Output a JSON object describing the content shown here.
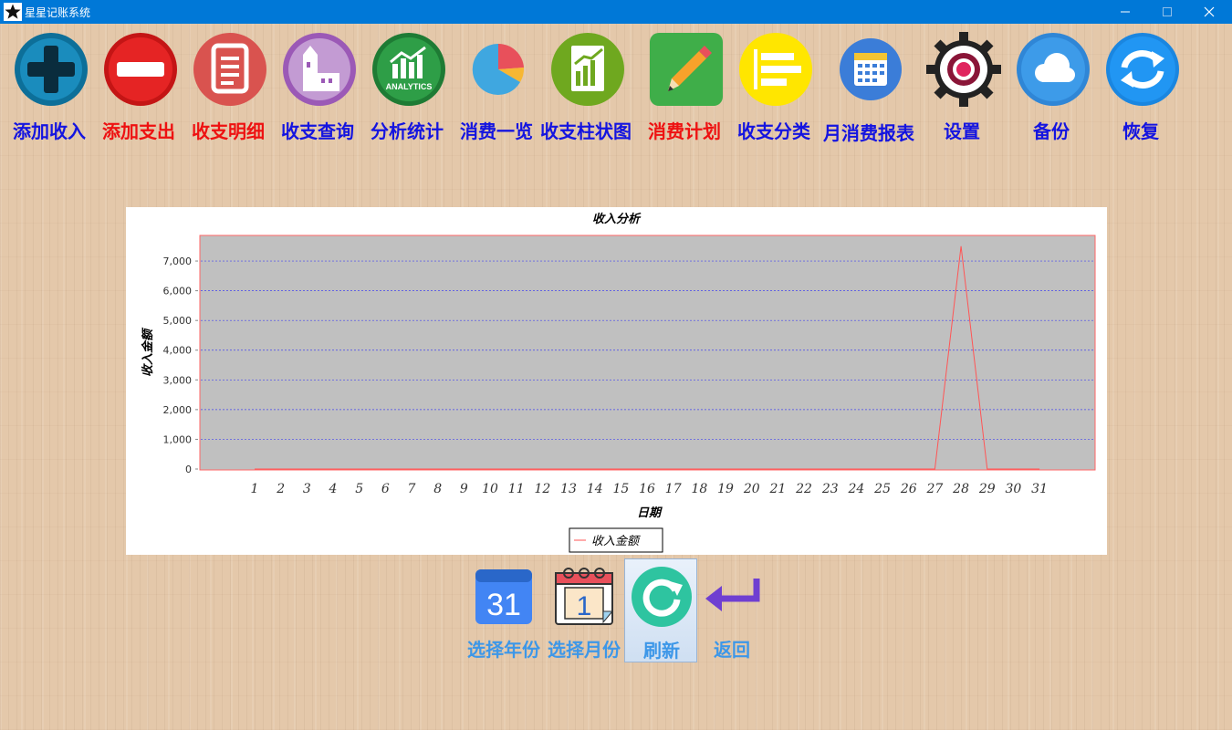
{
  "window": {
    "title": "星星记账系统",
    "minimize_icon": "minimize-icon",
    "maximize_icon": "maximize-icon",
    "close_icon": "close-icon"
  },
  "toolbar": {
    "items": [
      {
        "label": "添加收入",
        "icon": "add-icon",
        "color": "#1414e0"
      },
      {
        "label": "添加支出",
        "icon": "remove-icon",
        "color": "#ee1111"
      },
      {
        "label": "收支明细",
        "icon": "document-icon",
        "color": "#ee1111"
      },
      {
        "label": "收支查询",
        "icon": "building-icon",
        "color": "#1414e0"
      },
      {
        "label": "分析统计",
        "icon": "analytics-icon",
        "icon_text": "ANALYTICS",
        "color": "#1414e0"
      },
      {
        "label": "消费一览",
        "icon": "pie-chart-icon",
        "color": "#1414e0"
      },
      {
        "label": "收支柱状图",
        "icon": "bar-chart-icon",
        "color": "#1414e0"
      },
      {
        "label": "消费计划",
        "icon": "pencil-icon",
        "color": "#ee1111"
      },
      {
        "label": "收支分类",
        "icon": "list-icon",
        "color": "#1414e0"
      },
      {
        "label": "月消费报表",
        "icon": "calendar-icon",
        "color": "#1414e0"
      },
      {
        "label": "设置",
        "icon": "gear-icon",
        "color": "#1414e0"
      },
      {
        "label": "备份",
        "icon": "cloud-icon",
        "color": "#1414e0"
      },
      {
        "label": "恢复",
        "icon": "sync-icon",
        "color": "#1414e0"
      }
    ]
  },
  "chart_data": {
    "type": "line",
    "title": "收入分析",
    "xlabel": "日期",
    "ylabel": "收入金额",
    "legend": "收入金额",
    "legend_position": "bottom",
    "grid": true,
    "plot_background": "#c0c0c0",
    "line_color": "#ff5555",
    "grid_color": "#4444ee",
    "x": [
      1,
      2,
      3,
      4,
      5,
      6,
      7,
      8,
      9,
      10,
      11,
      12,
      13,
      14,
      15,
      16,
      17,
      18,
      19,
      20,
      21,
      22,
      23,
      24,
      25,
      26,
      27,
      28,
      29,
      30,
      31
    ],
    "y": [
      0,
      0,
      0,
      0,
      0,
      0,
      0,
      0,
      0,
      0,
      0,
      0,
      0,
      0,
      0,
      0,
      0,
      0,
      0,
      0,
      0,
      0,
      0,
      0,
      0,
      0,
      0,
      7500,
      0,
      0,
      0
    ],
    "yticks": [
      "0",
      "1,000",
      "2,000",
      "3,000",
      "4,000",
      "5,000",
      "6,000",
      "7,000"
    ],
    "ylim": [
      0,
      7800
    ]
  },
  "bottom_bar": {
    "items": [
      {
        "label": "选择年份",
        "icon": "calendar-31-icon",
        "icon_text": "31"
      },
      {
        "label": "选择月份",
        "icon": "calendar-1-icon",
        "icon_text": "1"
      },
      {
        "label": "刷新",
        "icon": "refresh-icon"
      },
      {
        "label": "返回",
        "icon": "return-arrow-icon"
      }
    ]
  }
}
